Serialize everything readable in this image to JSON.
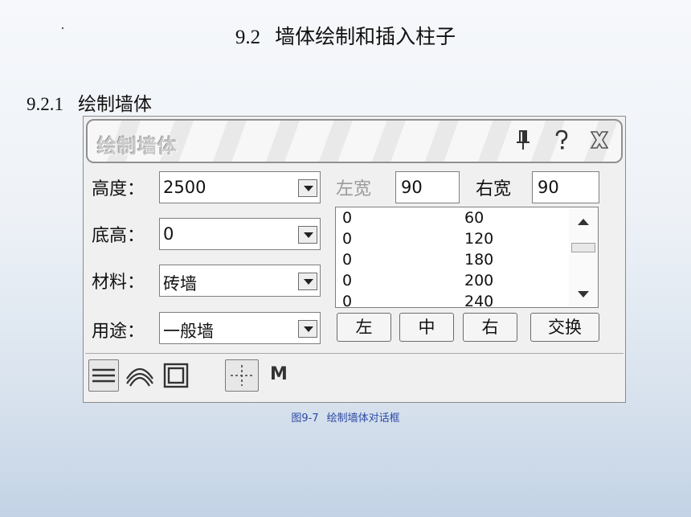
{
  "slide": {
    "title_num": "9.2",
    "title_text": "墙体绘制和插入柱子",
    "section_num": "9.2.1",
    "section_text": "绘制墙体",
    "caption_num": "图9-7",
    "caption_text": "绘制墙体对话框"
  },
  "dialog": {
    "title": "绘制墙体",
    "pin_glyph": "ᥱ",
    "help_glyph": "?",
    "close_glyph": "✕",
    "fields": {
      "height_label": "高度：",
      "height_value": "2500",
      "base_label": "底高：",
      "base_value": "0",
      "material_label": "材料：",
      "material_value": "砖墙",
      "usage_label": "用途：",
      "usage_value": "一般墙"
    },
    "left_width_label": "左宽",
    "left_width_value": "90",
    "right_width_label": "右宽",
    "right_width_value": "90",
    "list_rows": [
      {
        "a": "0",
        "b": "60"
      },
      {
        "a": "0",
        "b": "120"
      },
      {
        "a": "0",
        "b": "180"
      },
      {
        "a": "0",
        "b": "200"
      },
      {
        "a": "0",
        "b": "240"
      }
    ],
    "buttons": {
      "left": "左",
      "center": "中",
      "right": "右",
      "swap": "交换"
    },
    "mode_label": "M"
  }
}
